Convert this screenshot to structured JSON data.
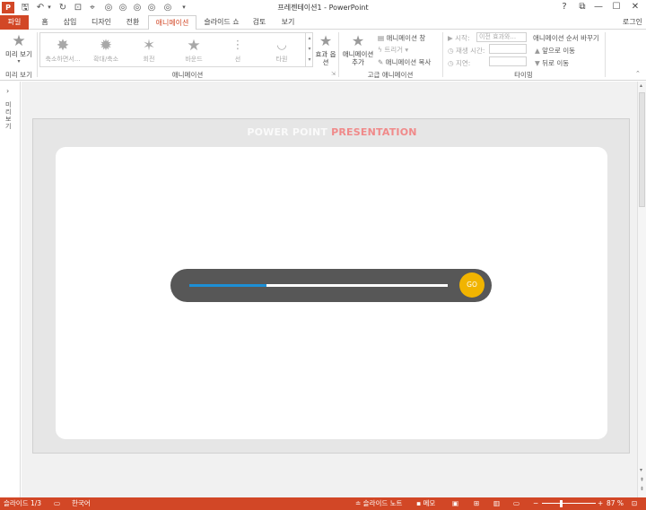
{
  "window": {
    "title": "프레젠테이션1 - PowerPoint",
    "help": "?",
    "restore": "⧉",
    "minimize": "—",
    "maximize": "☐",
    "close": "✕"
  },
  "tabs": [
    "파일",
    "홈",
    "삽입",
    "디자인",
    "전환",
    "애니메이션",
    "슬라이드 쇼",
    "검토",
    "보기"
  ],
  "active_tab": "애니메이션",
  "account": "로그인",
  "ribbon": {
    "preview_label_1": "미리 보기",
    "preview_group": "미리 보기",
    "animations": [
      {
        "label": "축소하면서...",
        "icon": "shrink-star-icon"
      },
      {
        "label": "확대/축소",
        "icon": "zoom-star-icon"
      },
      {
        "label": "회전",
        "icon": "spin-star-icon"
      },
      {
        "label": "바운드",
        "icon": "bounce-star-icon"
      },
      {
        "label": "선",
        "icon": "line-path-icon"
      },
      {
        "label": "타원",
        "icon": "arc-path-icon"
      }
    ],
    "effect_options": "효과 옵션",
    "animation_group": "애니메이션",
    "add_animation": "애니메이션 추가",
    "animation_pane": "애니메이션 창",
    "trigger": "트리거",
    "animation_painter": "애니메이션 복사",
    "advanced_group": "고급 애니메이션",
    "start_label": "시작:",
    "start_value": "이전 효과와...",
    "duration_label": "재생 시간:",
    "delay_label": "지연:",
    "reorder_title": "애니메이션 순서 바꾸기",
    "move_earlier": "앞으로 이동",
    "move_later": "뒤로 이동",
    "timing_group": "타이밍"
  },
  "thumbnails_label": "미리 보기",
  "slide": {
    "title_part1": "POWER POINT",
    "title_part2": "PRESENTATION",
    "progress": 0.3,
    "go_label": "GO",
    "colors": {
      "pill": "#575757",
      "fill": "#1d8fd6",
      "go": "#f1b400",
      "accent": "#f08a8a"
    }
  },
  "status": {
    "slide_count": "슬라이드 1/3",
    "language": "한국어",
    "notes": "슬라이드 노트",
    "comments": "메모",
    "zoom": "87 %"
  }
}
